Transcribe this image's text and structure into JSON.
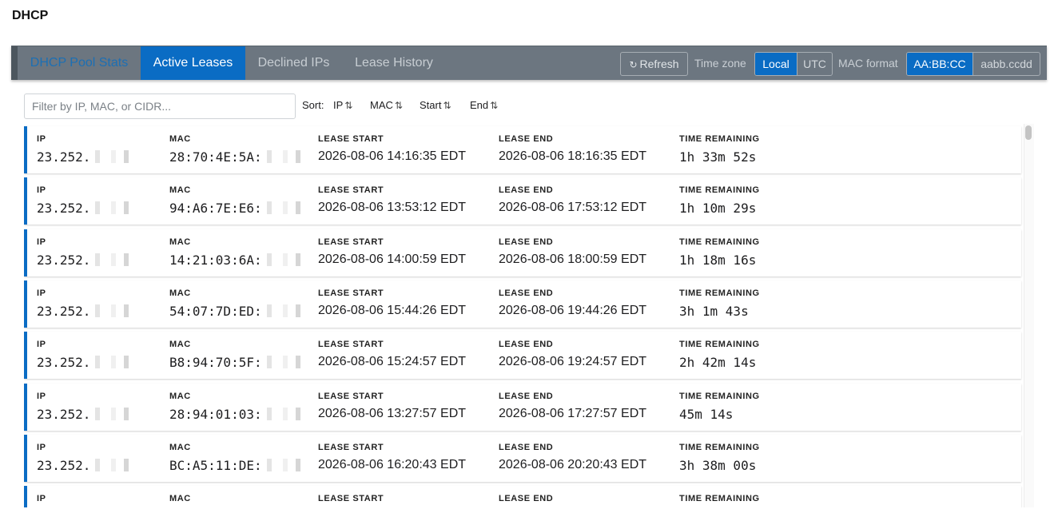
{
  "page_title": "DHCP",
  "tabs": [
    {
      "label": "DHCP Pool Stats",
      "active": false
    },
    {
      "label": "Active Leases",
      "active": true
    },
    {
      "label": "Declined IPs",
      "active": false
    },
    {
      "label": "Lease History",
      "active": false
    }
  ],
  "toolbar": {
    "refresh_label": "Refresh",
    "refresh_icon": "refresh-icon",
    "timezone_label": "Time zone",
    "timezone_options": [
      "Local",
      "UTC"
    ],
    "timezone_selected": "Local",
    "mac_format_label": "MAC format",
    "mac_format_options": [
      "AA:BB:CC",
      "aabb.ccdd"
    ],
    "mac_format_selected": "AA:BB:CC"
  },
  "filter": {
    "placeholder": "Filter by IP, MAC, or CIDR...",
    "value": ""
  },
  "sort": {
    "label": "Sort:",
    "options": [
      "IP",
      "MAC",
      "Start",
      "End"
    ],
    "sort_icon": "up-down-arrows-icon"
  },
  "columns": {
    "ip": "IP",
    "mac": "MAC",
    "start": "LEASE START",
    "end": "LEASE END",
    "remaining": "TIME REMAINING"
  },
  "leases": [
    {
      "ip": "23.252.",
      "mac": "28:70:4E:5A:",
      "start": "2026-08-06 14:16:35 EDT",
      "end": "2026-08-06 18:16:35 EDT",
      "remaining": "1h 33m 52s"
    },
    {
      "ip": "23.252.",
      "mac": "94:A6:7E:E6:",
      "start": "2026-08-06 13:53:12 EDT",
      "end": "2026-08-06 17:53:12 EDT",
      "remaining": "1h 10m 29s"
    },
    {
      "ip": "23.252.",
      "mac": "14:21:03:6A:",
      "start": "2026-08-06 14:00:59 EDT",
      "end": "2026-08-06 18:00:59 EDT",
      "remaining": "1h 18m 16s"
    },
    {
      "ip": "23.252.",
      "mac": "54:07:7D:ED:",
      "start": "2026-08-06 15:44:26 EDT",
      "end": "2026-08-06 19:44:26 EDT",
      "remaining": "3h 1m 43s"
    },
    {
      "ip": "23.252.",
      "mac": "B8:94:70:5F:",
      "start": "2026-08-06 15:24:57 EDT",
      "end": "2026-08-06 19:24:57 EDT",
      "remaining": "2h 42m 14s"
    },
    {
      "ip": "23.252.",
      "mac": "28:94:01:03:",
      "start": "2026-08-06 13:27:57 EDT",
      "end": "2026-08-06 17:27:57 EDT",
      "remaining": "45m 14s"
    },
    {
      "ip": "23.252.",
      "mac": "BC:A5:11:DE:",
      "start": "2026-08-06 16:20:43 EDT",
      "end": "2026-08-06 20:20:43 EDT",
      "remaining": "3h 38m 00s"
    },
    {
      "ip": "",
      "mac": "",
      "start": "",
      "end": "",
      "remaining": ""
    }
  ],
  "colors": {
    "accent": "#0a6cc4",
    "tabbar": "#6c7680"
  }
}
